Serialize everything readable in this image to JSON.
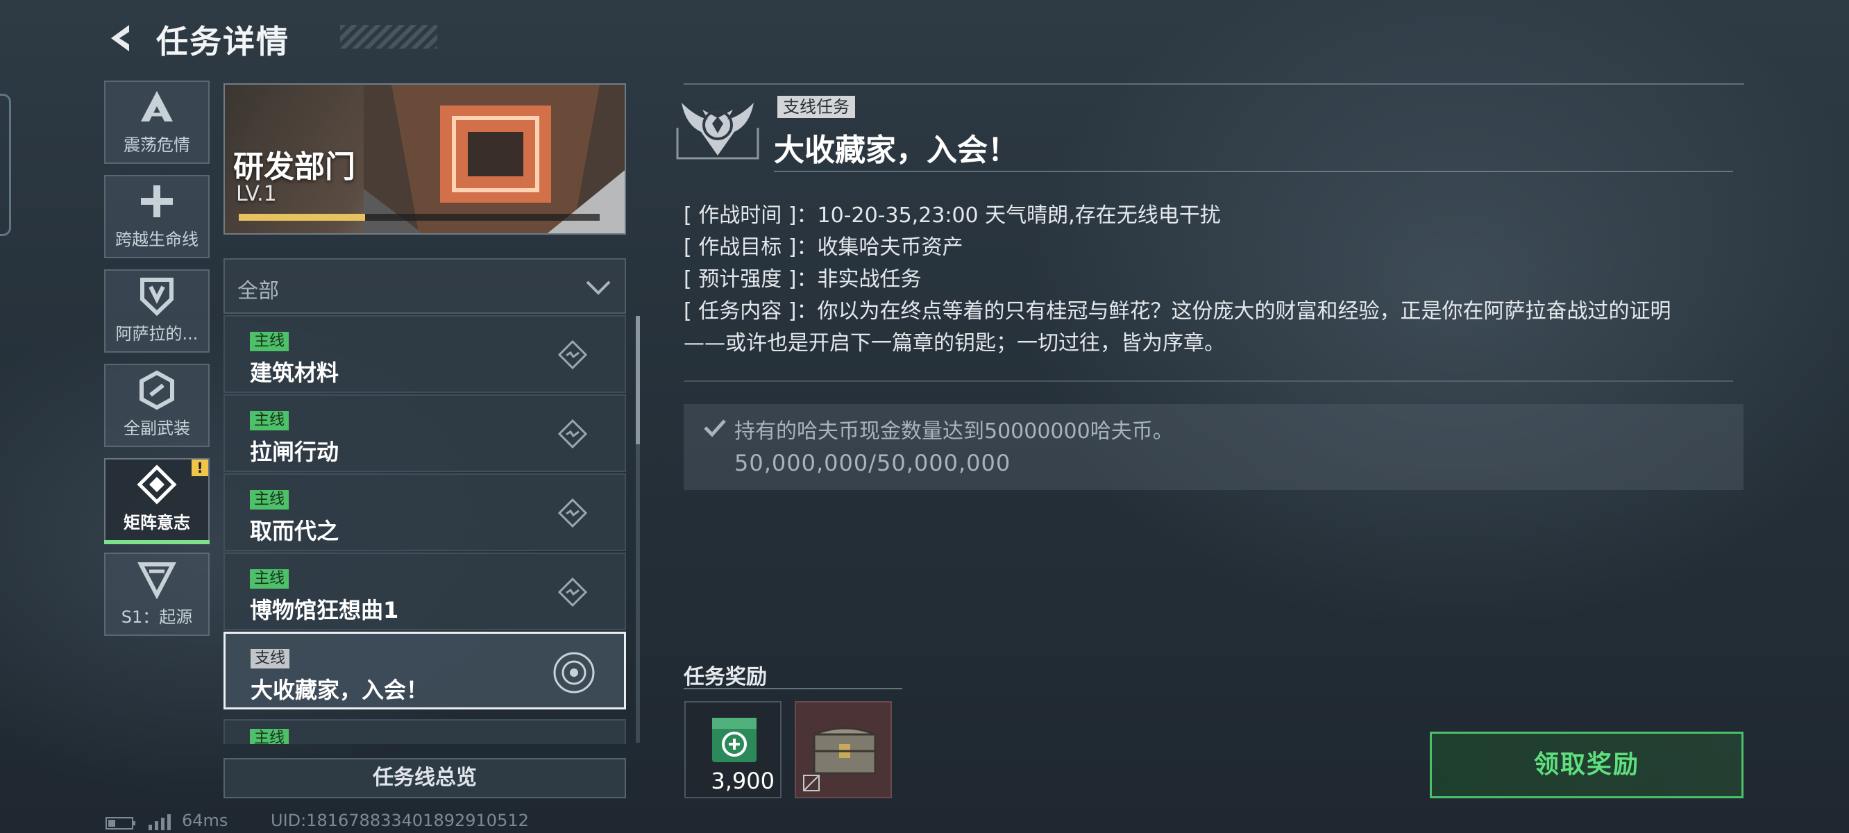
{
  "header": {
    "title": "任务详情"
  },
  "categories": [
    {
      "label": "震荡危情",
      "icon": "delta-icon"
    },
    {
      "label": "跨越生命线",
      "icon": "cross-icon"
    },
    {
      "label": "阿萨拉的...",
      "icon": "shield-icon"
    },
    {
      "label": "全副武装",
      "icon": "hex-icon"
    },
    {
      "label": "矩阵意志",
      "icon": "diamond-icon",
      "active": true,
      "alert": "!"
    },
    {
      "label": "S1：起源",
      "icon": "triangle-icon"
    }
  ],
  "department": {
    "name": "研发部门",
    "level": "LV.1",
    "progress": 0.35
  },
  "filter": {
    "label": "全部"
  },
  "quests": [
    {
      "tag": "主线",
      "name": "建筑材料"
    },
    {
      "tag": "主线",
      "name": "拉闸行动"
    },
    {
      "tag": "主线",
      "name": "取而代之"
    },
    {
      "tag": "主线",
      "name": "博物馆狂想曲1"
    },
    {
      "tag": "支线",
      "name": "大收藏家，入会！",
      "selected": true
    },
    {
      "tag": "主线"
    }
  ],
  "overview_button": "任务线总览",
  "status": {
    "ping": "64ms",
    "uid": "UID:1816788334018929105​12"
  },
  "mission": {
    "type_tag": "支线任务",
    "title": "大收藏家，入会！",
    "time": "[ 作战时间 ]：10-20-35,23:00 天气晴朗,存在无线电干扰",
    "goal": "[ 作战目标 ]：收集哈夫币资产",
    "intensity": "[ 预计强度 ]：非实战任务",
    "content_line1": "[ 任务内容 ]：你以为在终点等着的只有桂冠与鲜花？这份庞大的财富和经验，正是你在阿萨拉奋战过的证明",
    "content_line2": "——或许也是开启下一篇章的钥匙；一切过往，皆为序章。",
    "objective": "持有的哈夫币现金数量达到50000000哈夫币。",
    "objective_progress": "50,000,000/50,000,000"
  },
  "rewards": {
    "title": "任务奖励",
    "items": [
      {
        "icon": "currency-crate-icon",
        "qty": "3,900"
      },
      {
        "icon": "treasure-chest-icon"
      }
    ]
  },
  "claim_button": "领取奖励",
  "colors": {
    "accent_green": "#4ec06a",
    "claim_text": "#5fe07f",
    "level_bar": "#e6c35f",
    "alert": "#f0c64a"
  }
}
